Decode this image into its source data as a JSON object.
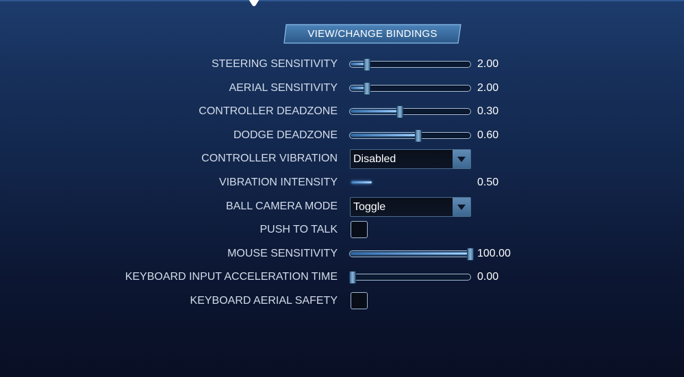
{
  "header": {
    "bindings_button_label": "VIEW/CHANGE BINDINGS"
  },
  "settings": [
    {
      "key": "steering-sensitivity",
      "label": "STEERING SENSITIVITY",
      "control": "slider",
      "level": 0.12,
      "value": "2.00"
    },
    {
      "key": "aerial-sensitivity",
      "label": "AERIAL SENSITIVITY",
      "control": "slider",
      "level": 0.12,
      "value": "2.00"
    },
    {
      "key": "controller-deadzone",
      "label": "CONTROLLER DEADZONE",
      "control": "slider",
      "level": 0.4,
      "value": "0.30"
    },
    {
      "key": "dodge-deadzone",
      "label": "DODGE DEADZONE",
      "control": "slider",
      "level": 0.56,
      "value": "0.60"
    },
    {
      "key": "controller-vibration",
      "label": "CONTROLLER VIBRATION",
      "control": "dropdown",
      "selected": "Disabled"
    },
    {
      "key": "vibration-intensity",
      "label": "VIBRATION INTENSITY",
      "control": "disabled-slider",
      "value": "0.50"
    },
    {
      "key": "ball-camera-mode",
      "label": "BALL CAMERA MODE",
      "control": "dropdown",
      "selected": "Toggle"
    },
    {
      "key": "push-to-talk",
      "label": "PUSH TO TALK",
      "control": "checkbox",
      "checked": false
    },
    {
      "key": "mouse-sensitivity",
      "label": "MOUSE SENSITIVITY",
      "control": "slider",
      "level": 1.0,
      "value": "100.00"
    },
    {
      "key": "keyboard-input-acceleration-time",
      "label": "KEYBOARD INPUT ACCELERATION TIME",
      "control": "slider",
      "level": 0.0,
      "value": "0.00"
    },
    {
      "key": "keyboard-aerial-safety",
      "label": "KEYBOARD AERIAL SAFETY",
      "control": "checkbox",
      "checked": false
    }
  ],
  "colors": {
    "background_top": "#1d3c6d",
    "background_bottom": "#090f24",
    "accent": "#6fb6ff",
    "label_text": "#d3dcea",
    "value_text": "#ffffff"
  },
  "icons": {
    "top_emblem": "emblem-icon",
    "dropdown_arrow": "chevron-down-icon"
  }
}
